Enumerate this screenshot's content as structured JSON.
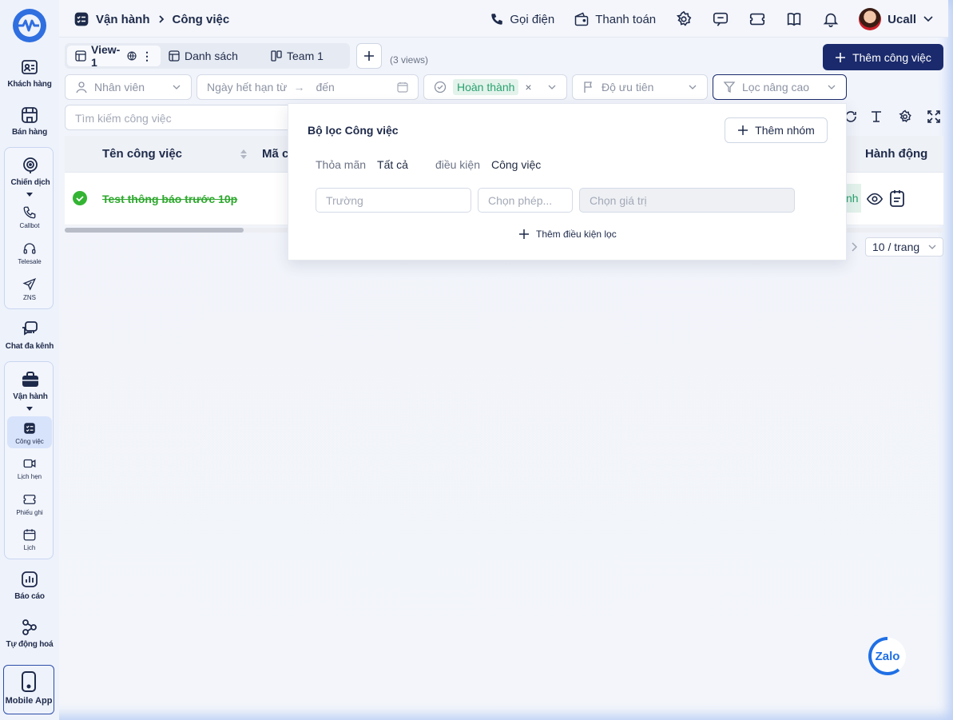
{
  "sidebar": {
    "items": [
      {
        "label": "Khách hàng",
        "icon": "contact-card-icon"
      },
      {
        "label": "Bán hàng",
        "icon": "store-icon"
      },
      {
        "label": "Chiến dịch",
        "icon": "target-icon"
      },
      {
        "label": "Chat đa kênh",
        "icon": "chat-bubbles-icon"
      },
      {
        "label": "Vận hành",
        "icon": "briefcase-icon"
      },
      {
        "label": "Báo cáo",
        "icon": "chart-icon"
      },
      {
        "label": "Tự động hoá",
        "icon": "flow-icon"
      },
      {
        "label": "Mobile App",
        "icon": "phone-icon"
      }
    ],
    "campaign_sub": [
      {
        "label": "Callbot",
        "icon": "phone-call-icon"
      },
      {
        "label": "Telesale",
        "icon": "headset-icon"
      },
      {
        "label": "ZNS",
        "icon": "send-icon"
      }
    ],
    "ops_sub": [
      {
        "label": "Công việc",
        "icon": "task-list-icon"
      },
      {
        "label": "Lịch hẹn",
        "icon": "video-icon"
      },
      {
        "label": "Phiếu ghi",
        "icon": "ticket-icon"
      },
      {
        "label": "Lịch",
        "icon": "calendar-icon"
      }
    ]
  },
  "header": {
    "breadcrumb": [
      "Vận hành",
      "Công việc"
    ],
    "call_label": "Gọi điện",
    "payment_label": "Thanh toán",
    "user_name": "Ucall"
  },
  "tabs": {
    "items": [
      "View-1",
      "Danh sách",
      "Team 1"
    ],
    "views_count": "(3 views)"
  },
  "actions": {
    "add_task": "Thêm công việc"
  },
  "filters": {
    "employee": "Nhân viên",
    "due_from": "Ngày hết hạn từ",
    "due_to": "đến",
    "status_chip": "Hoàn thành",
    "priority": "Độ ưu tiên",
    "advanced": "Lọc nâng cao"
  },
  "search": {
    "placeholder": "Tìm kiếm công việc"
  },
  "table": {
    "headers": {
      "name": "Tên công việc",
      "code": "Mã c",
      "actions": "Hành động"
    },
    "rows": [
      {
        "name": "Test thông báo trước 10p",
        "status_tail": "nh",
        "completed": true
      }
    ]
  },
  "pagination": {
    "page_size": "10 / trang"
  },
  "advanced_filter": {
    "title": "Bộ lọc Công việc",
    "add_group": "Thêm nhóm",
    "satisfy_label": "Thỏa mãn",
    "satisfy_value": "Tất cả",
    "condition_label": "điều kiện",
    "condition_value": "Công việc",
    "field_placeholder": "Trường",
    "operator_placeholder": "Chọn phép...",
    "value_placeholder": "Chọn giá trị",
    "add_condition": "Thêm điều kiện lọc"
  },
  "zalo_label": "Zalo",
  "colors": {
    "primary": "#1a2a6c",
    "success": "#2ea82e",
    "chip_bg": "#e3f3ec",
    "chip_text": "#2aa16e"
  }
}
